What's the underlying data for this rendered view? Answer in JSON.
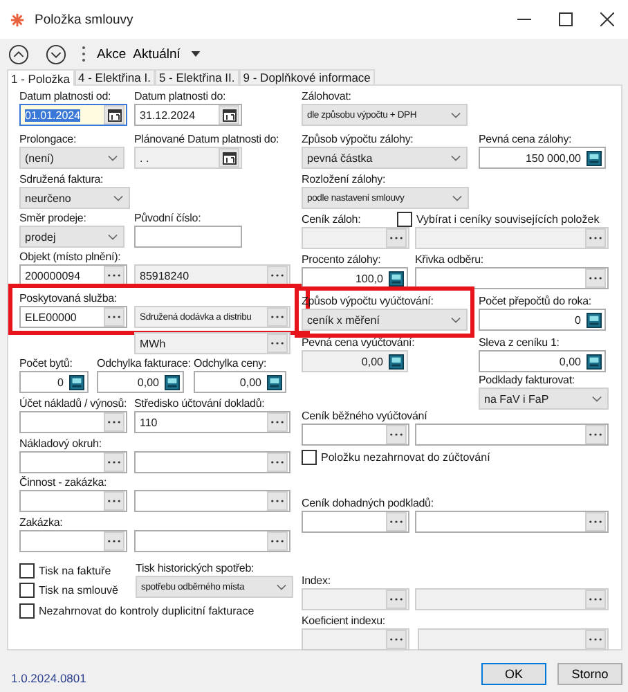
{
  "window": {
    "title": "Položka smlouvy"
  },
  "toolbar": {
    "menus": [
      "Akce",
      "Aktuální"
    ]
  },
  "tabs": [
    {
      "label": "1 - Položka",
      "selected": true
    },
    {
      "label": "4 - Elektřina I.",
      "selected": false
    },
    {
      "label": "5 - Elektřina II.",
      "selected": false
    },
    {
      "label": "9 - Doplňkové informace",
      "selected": false
    }
  ],
  "left": [
    {
      "highlighted": false,
      "fields": [
        {
          "label": "Datum platnosti od:",
          "kind": "date",
          "value": "01.01.2024",
          "disabled": false,
          "focused": true
        },
        {
          "label": "Datum platnosti do:",
          "kind": "date",
          "value": "31.12.2024",
          "disabled": false,
          "focused": false
        }
      ]
    },
    {
      "highlighted": false,
      "fields": [
        {
          "label": "Prolongace:",
          "kind": "select",
          "value": "(není)",
          "disabled": false,
          "focused": false
        },
        {
          "label": "Plánované Datum platnosti do:",
          "kind": "date",
          "value": ". .",
          "disabled": true,
          "focused": false
        }
      ]
    },
    {
      "highlighted": false,
      "fields": [
        {
          "label": "Sdružená faktura:",
          "kind": "select",
          "value": "neurčeno",
          "disabled": false,
          "focused": false
        }
      ]
    },
    {
      "highlighted": false,
      "fields": [
        {
          "label": "Směr prodeje:",
          "kind": "select",
          "value": "prodej",
          "disabled": false,
          "focused": false
        },
        {
          "label": "Původní číslo:",
          "kind": "text",
          "disabled": false,
          "focused": false
        }
      ]
    },
    {
      "highlighted": false,
      "fields": [
        {
          "label": "Objekt (místo plnění):",
          "kind": "lookup",
          "value": "200000094",
          "disabled": false,
          "focused": false
        },
        {
          "kind": "lookup",
          "value": "85918240",
          "disabled": true,
          "focused": false
        }
      ]
    },
    {
      "highlighted": true,
      "fields": [
        {
          "label": "Poskytovaná služba:",
          "kind": "lookup",
          "value": "ELE00000",
          "disabled": false,
          "focused": false
        },
        {
          "kind": "lookup",
          "value": "Sdružená dodávka a distribu",
          "disabled": true,
          "focused": false
        }
      ]
    },
    {
      "highlighted": false,
      "fields": [
        {
          "kind": "lookup",
          "value": "MWh",
          "disabled": true,
          "focused": false
        }
      ]
    },
    {
      "highlighted": false,
      "fields": [
        {
          "label": "Počet bytů:",
          "kind": "number",
          "value": "0",
          "disabled": false,
          "focused": false
        },
        {
          "label": "Odchylka fakturace:",
          "kind": "number",
          "value": "0,00",
          "disabled": false,
          "focused": false
        },
        {
          "label": "Odchylka ceny:",
          "kind": "number",
          "value": "0,00",
          "disabled": false,
          "focused": false
        }
      ]
    },
    {
      "highlighted": false,
      "fields": [
        {
          "label": "Účet nákladů / výnosů:",
          "kind": "lookup",
          "disabled": false,
          "focused": false
        },
        {
          "label": "Středisko účtování dokladů:",
          "kind": "lookup",
          "value": "110",
          "disabled": false,
          "focused": false
        }
      ]
    },
    {
      "highlighted": false,
      "fields": [
        {
          "label": "Nákladový okruh:",
          "kind": "lookup",
          "disabled": false,
          "focused": false
        },
        {
          "kind": "lookup",
          "disabled": false,
          "focused": false
        }
      ]
    },
    {
      "highlighted": false,
      "fields": [
        {
          "label": "Činnost - zakázka:",
          "kind": "lookup",
          "disabled": false,
          "focused": false
        },
        {
          "kind": "lookup",
          "disabled": false,
          "focused": false
        }
      ]
    },
    {
      "highlighted": false,
      "fields": [
        {
          "label": "Zakázka:",
          "kind": "lookup",
          "disabled": false,
          "focused": false
        },
        {
          "kind": "lookup",
          "disabled": false,
          "focused": false
        }
      ]
    },
    {
      "highlighted": false,
      "fields": [
        {
          "kind": "checkbox",
          "label": "Tisk na faktuře",
          "checked": false
        },
        {
          "kind": "checkbox",
          "label": "Tisk na smlouvě",
          "checked": false
        },
        {
          "label": "Tisk historických spotřeb:",
          "kind": "select",
          "value": "spotřebu odběrného místa",
          "disabled": false,
          "focused": false
        }
      ]
    },
    {
      "highlighted": false,
      "fields": [
        {
          "kind": "checkbox",
          "label": "Nezahrnovat do kontroly duplicitní fakturace",
          "checked": false
        }
      ]
    }
  ],
  "right": [
    {
      "fields": [
        {
          "label": "Zálohovat:",
          "kind": "select",
          "value": "dle způsobu výpočtu + DPH",
          "disabled": false,
          "focused": false,
          "highlighted": false
        }
      ]
    },
    {
      "fields": [
        {
          "label": "Způsob výpočtu zálohy:",
          "kind": "select",
          "value": "pevná částka",
          "disabled": false,
          "focused": false,
          "highlighted": false
        },
        {
          "label": "Pevná cena zálohy:",
          "kind": "number",
          "value": "150 000,00",
          "disabled": false,
          "focused": false,
          "highlighted": false
        }
      ]
    },
    {
      "fields": [
        {
          "label": "Rozložení zálohy:",
          "kind": "select",
          "value": "podle nastavení smlouvy",
          "disabled": false,
          "focused": false,
          "highlighted": false
        }
      ]
    },
    {
      "fields": [
        {
          "label": "Ceník záloh:",
          "kind": "lookup",
          "disabled": true,
          "focused": false,
          "highlighted": false
        },
        {
          "checkbox": {
            "label": "Vybírat i ceníky souvisejících položek",
            "checked": false
          },
          "kind": "lookup",
          "disabled": true,
          "focused": false,
          "highlighted": false
        }
      ]
    },
    {
      "fields": [
        {
          "label": "Procento zálohy:",
          "kind": "number",
          "value": "100,0",
          "disabled": false,
          "focused": false,
          "highlighted": false
        },
        {
          "label": "Křivka odběru:",
          "kind": "lookup",
          "disabled": false,
          "focused": false,
          "highlighted": false
        }
      ]
    },
    {
      "fields": [
        {
          "label": "Způsob výpočtu vyúčtování:",
          "kind": "select",
          "value": "ceník x měření",
          "disabled": false,
          "focused": false,
          "highlighted": true
        },
        {
          "label": "Počet přepočtů do roka:",
          "kind": "number",
          "value": "0",
          "disabled": false,
          "focused": false,
          "highlighted": false
        }
      ]
    },
    {
      "fields": [
        {
          "label": "Pevná cena vyúčtování:",
          "kind": "number",
          "value": "0,00",
          "disabled": true,
          "focused": false,
          "highlighted": false
        },
        {
          "label": "Sleva z ceníku 1:",
          "kind": "number",
          "value": "0,00",
          "disabled": false,
          "focused": false,
          "highlighted": false
        }
      ]
    },
    {
      "fields": [
        {
          "label": "Podklady fakturovat:",
          "kind": "select",
          "value": "na FaV i FaP",
          "disabled": false,
          "focused": false,
          "highlighted": false
        }
      ]
    },
    {
      "fields": [
        {
          "label": "Ceník běžného vyúčtování",
          "kind": "lookup",
          "disabled": false,
          "focused": false,
          "highlighted": false
        },
        {
          "kind": "lookup",
          "disabled": false,
          "focused": false,
          "highlighted": false
        }
      ]
    },
    {
      "fields": [
        {
          "kind": "checkbox",
          "label": "Položku nezahrnovat do zúčtování",
          "checked": false
        }
      ]
    },
    {
      "fields": [
        {
          "label": "Ceník dohadných podkladů:",
          "kind": "lookup",
          "disabled": false,
          "focused": false,
          "highlighted": false
        },
        {
          "kind": "lookup",
          "disabled": false,
          "focused": false,
          "highlighted": false
        }
      ]
    },
    {
      "fields": [
        {
          "label": "Index:",
          "kind": "lookup",
          "disabled": true,
          "focused": false,
          "highlighted": false
        },
        {
          "kind": "lookup",
          "disabled": true,
          "focused": false,
          "highlighted": false
        }
      ]
    },
    {
      "fields": [
        {
          "label": "Koeficient indexu:",
          "kind": "lookup",
          "disabled": true,
          "focused": false,
          "highlighted": false
        },
        {
          "kind": "lookup",
          "disabled": true,
          "focused": false,
          "highlighted": false
        }
      ]
    }
  ],
  "version": "1.0.2024.0801",
  "buttons": [
    {
      "label": "OK",
      "default": true
    },
    {
      "label": "Storno",
      "default": false
    }
  ]
}
